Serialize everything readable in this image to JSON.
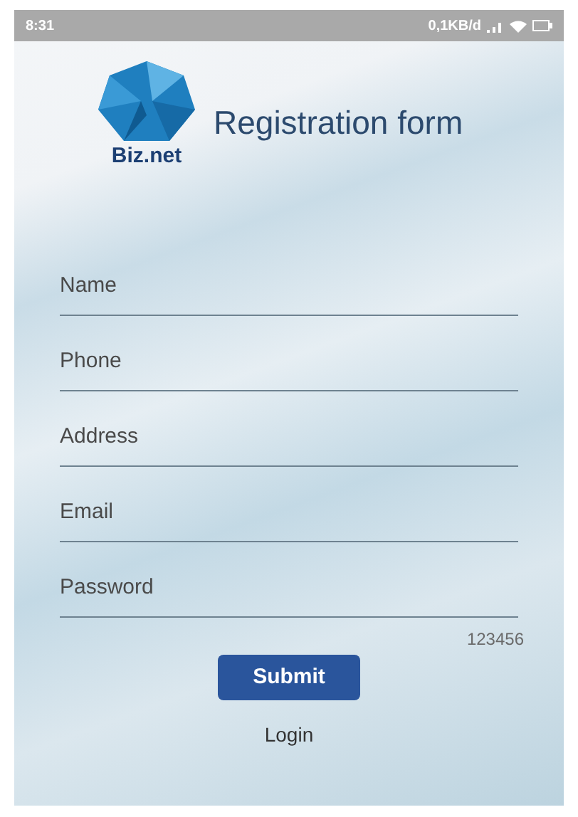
{
  "status_bar": {
    "time": "8:31",
    "data_rate": "0,1KB/d"
  },
  "header": {
    "brand": "Biz.net",
    "title": "Registration form"
  },
  "fields": [
    {
      "placeholder": "Name"
    },
    {
      "placeholder": "Phone"
    },
    {
      "placeholder": "Address"
    },
    {
      "placeholder": "Email"
    },
    {
      "placeholder": "Password"
    }
  ],
  "hint": "123456",
  "submit": "Submit",
  "login": "Login"
}
